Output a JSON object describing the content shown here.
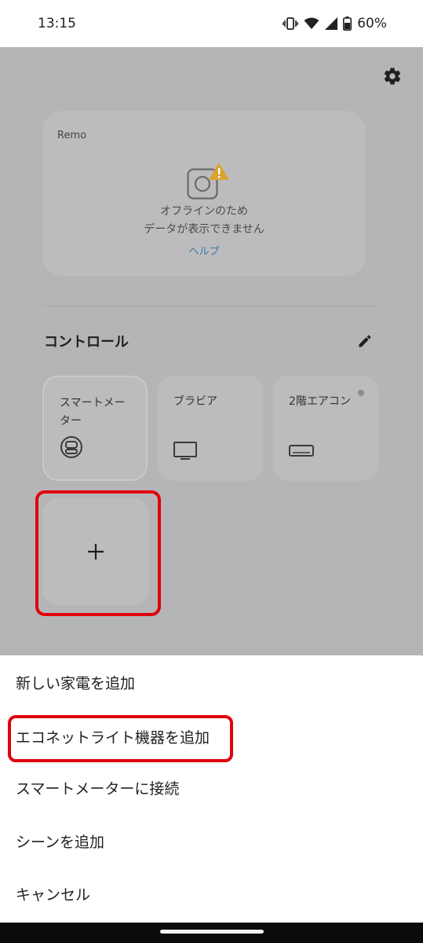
{
  "status_bar": {
    "time": "13:15",
    "battery_percent": "60%",
    "icons": [
      "vibrate-icon",
      "wifi-icon",
      "signal-icon",
      "battery-icon"
    ]
  },
  "header": {
    "settings_icon": "gear-icon"
  },
  "remo_card": {
    "title": "Remo",
    "device_icon": "remo-device-icon",
    "warning_icon": "warning-icon",
    "offline_line1": "オフラインのため",
    "offline_line2": "データが表示できません",
    "help_link": "ヘルプ"
  },
  "controls": {
    "section_title": "コントロール",
    "edit_icon": "pencil-icon",
    "tiles": [
      {
        "label": "スマートメーター",
        "icon": "smart-meter-icon"
      },
      {
        "label": "ブラビア",
        "icon": "tv-icon"
      },
      {
        "label": "2階エアコン",
        "icon": "air-conditioner-icon"
      }
    ],
    "add_icon": "plus-icon"
  },
  "sheet": {
    "items": [
      "新しい家電を追加",
      "エコネットライト機器を追加",
      "スマートメーターに接続",
      "シーンを追加",
      "キャンセル"
    ]
  },
  "colors": {
    "scrim": "#b5b5b7",
    "card": "#bcbcbe",
    "highlight_red": "#e0000e",
    "help_link": "#3b79a3",
    "warning": "#d9a431"
  }
}
